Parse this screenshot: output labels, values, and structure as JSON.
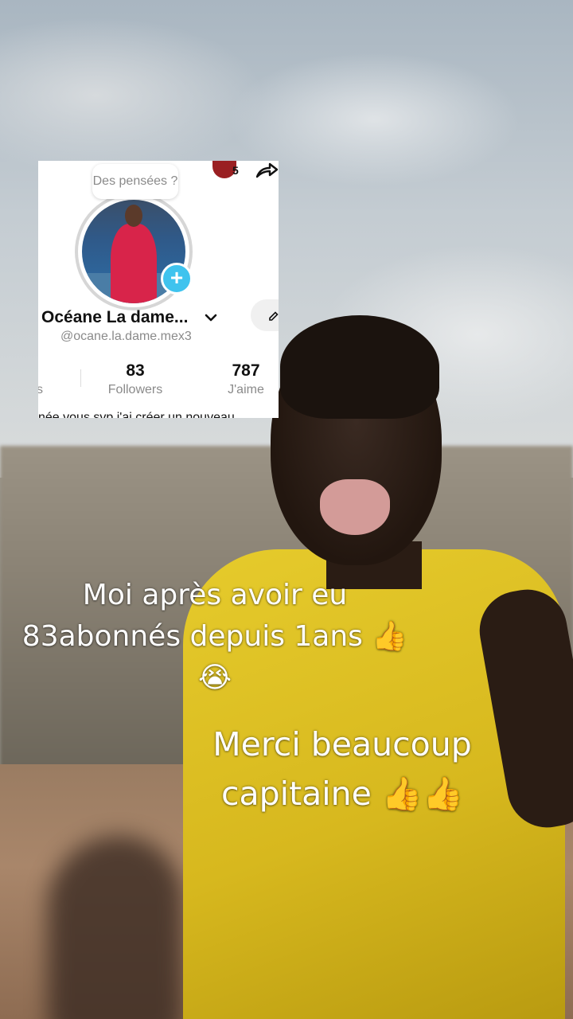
{
  "profile_card": {
    "thoughts_bubble": "Des pensées ?",
    "notification_count": "5",
    "name": "Océane La dame...",
    "handle": "@ocane.la.dame.mex3",
    "stats": [
      {
        "value": "",
        "label": "s"
      },
      {
        "value": "83",
        "label": "Followers"
      },
      {
        "value": "787",
        "label": "J'aime"
      }
    ],
    "bio_partial": "née vous svp j'ai créer un nouveau"
  },
  "captions": {
    "line1": "Moi après avoir eu 83abonnés depuis 1ans 👍😭",
    "line2": "Merci beaucoup capitaine 👍👍"
  },
  "colors": {
    "plus_badge": "#3fc3ee",
    "shirt": "#e0c225"
  }
}
